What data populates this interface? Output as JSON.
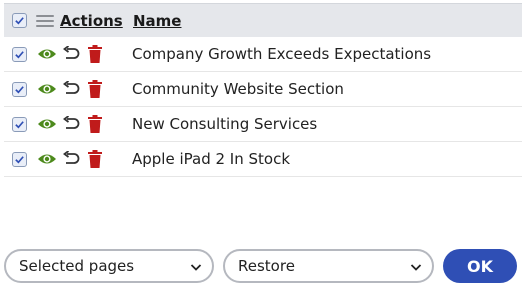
{
  "header": {
    "actions_label": "Actions",
    "name_label": "Name"
  },
  "rows": [
    {
      "name": "Company Growth Exceeds Expectations",
      "checked": true
    },
    {
      "name": "Community Website Section",
      "checked": true
    },
    {
      "name": "New Consulting Services",
      "checked": true
    },
    {
      "name": "Apple iPad 2 In Stock",
      "checked": true
    }
  ],
  "footer": {
    "scope_select": {
      "value": "Selected pages"
    },
    "action_select": {
      "value": "Restore"
    },
    "ok_label": "OK"
  },
  "colors": {
    "eye": "#4d8a1c",
    "trash": "#c01b1b",
    "ok_button": "#2f4fb5",
    "header_bg": "#e5e7eb"
  },
  "icons": {
    "view": "eye-icon",
    "restore": "undo-icon",
    "delete": "trash-icon",
    "menu": "hamburger-icon"
  }
}
